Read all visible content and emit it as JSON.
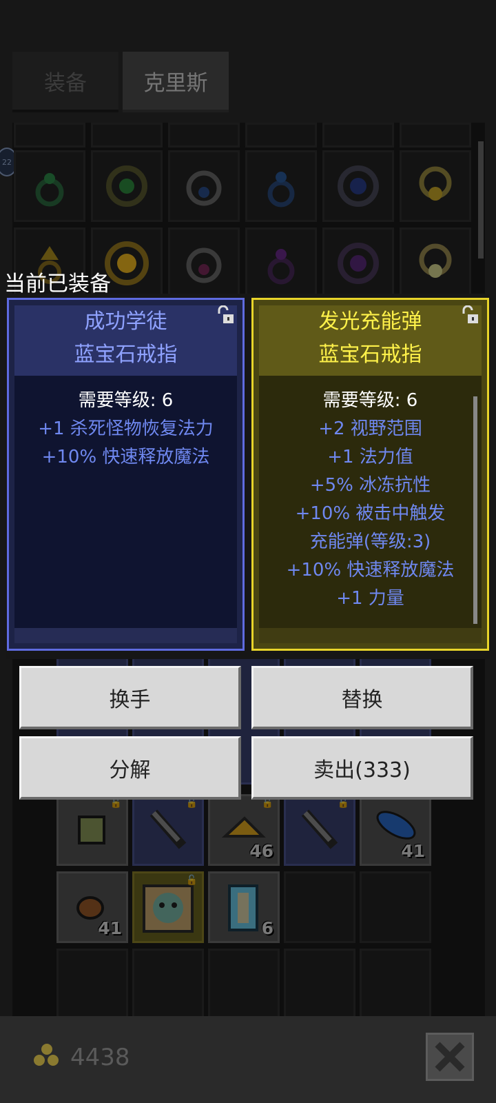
{
  "tabs": [
    {
      "label": "装备",
      "active": false
    },
    {
      "label": "克里斯",
      "active": true
    }
  ],
  "badge_text": "22",
  "equipped_label": "当前已装备",
  "comparison": {
    "left": {
      "name_line1": "成功学徒",
      "name_line2": "蓝宝石戒指",
      "requirement": "需要等级: 6",
      "stats": [
        "+1 杀死怪物恢复法力",
        "+10% 快速释放魔法"
      ],
      "border_color": "#5f6be0"
    },
    "right": {
      "name_line1": "发光充能弹",
      "name_line2": "蓝宝石戒指",
      "requirement": "需要等级: 6",
      "stats": [
        "+2 视野范围",
        "+1 法力值",
        "+5% 冰冻抗性",
        "+10% 被击中触发",
        "充能弹(等级:3)",
        "+10% 快速释放魔法",
        "+1 力量"
      ],
      "border_color": "#e8d42a"
    }
  },
  "actions": {
    "swap_hand": "换手",
    "replace": "替换",
    "salvage": "分解",
    "sell": "卖出(333)"
  },
  "inventory_counts": {
    "gold_pile": "46",
    "blue_feather": "41",
    "meat": "41",
    "scroll": "6"
  },
  "gold": "4438",
  "icons": [
    "lock-icon",
    "close-icon",
    "gold-coins-icon",
    "ring-icon"
  ]
}
